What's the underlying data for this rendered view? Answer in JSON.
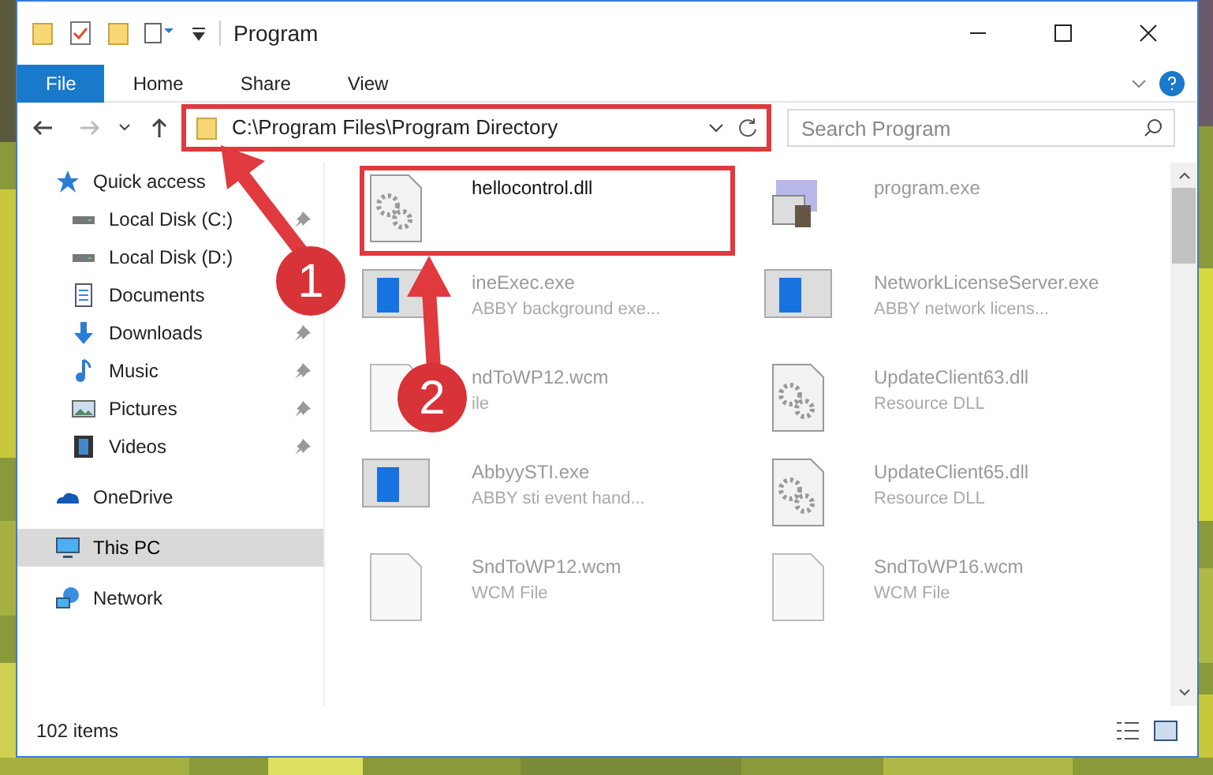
{
  "window": {
    "title": "Program"
  },
  "ribbon": {
    "tabs": [
      {
        "label": "File",
        "selected": true
      },
      {
        "label": "Home",
        "selected": false
      },
      {
        "label": "Share",
        "selected": false
      },
      {
        "label": "View",
        "selected": false
      }
    ]
  },
  "address": {
    "path": "C:\\Program Files\\Program Directory"
  },
  "search": {
    "placeholder": "Search Program"
  },
  "sidebar": {
    "items": [
      {
        "label": "Quick access",
        "kind": "star",
        "pinned": false,
        "selected": false,
        "children": [
          {
            "label": "Local Disk (C:)",
            "kind": "drive",
            "pinned": true,
            "selected": false
          },
          {
            "label": "Local Disk (D:)",
            "kind": "drive",
            "pinned": false,
            "selected": false
          },
          {
            "label": "Documents",
            "kind": "doc",
            "pinned": false,
            "selected": false
          },
          {
            "label": "Downloads",
            "kind": "download",
            "pinned": true,
            "selected": false
          },
          {
            "label": "Music",
            "kind": "music",
            "pinned": true,
            "selected": false
          },
          {
            "label": "Pictures",
            "kind": "pictures",
            "pinned": true,
            "selected": false
          },
          {
            "label": "Videos",
            "kind": "videos",
            "pinned": true,
            "selected": false
          }
        ]
      },
      {
        "label": "OneDrive",
        "kind": "cloud",
        "pinned": false,
        "selected": false
      },
      {
        "label": "This PC",
        "kind": "pc",
        "pinned": false,
        "selected": true
      },
      {
        "label": "Network",
        "kind": "network",
        "pinned": false,
        "selected": false
      }
    ]
  },
  "files": [
    {
      "name": "hellocontrol.dll",
      "kind": "dll",
      "highlighted": true
    },
    {
      "name": "program.exe",
      "kind": "exe",
      "highlighted": false
    },
    {
      "name": "ineExec.exe",
      "description": "ABBY background exe...",
      "kind": "window",
      "highlighted": false
    },
    {
      "name": "NetworkLicenseServer.exe",
      "description": "ABBY network licens...",
      "kind": "window",
      "highlighted": false
    },
    {
      "name": "ndToWP12.wcm",
      "description": "ile",
      "kind": "blank",
      "highlighted": false
    },
    {
      "name": "UpdateClient63.dll",
      "description": "Resource DLL",
      "kind": "dll",
      "highlighted": false
    },
    {
      "name": "AbbyySTI.exe",
      "description": "ABBY sti event hand...",
      "kind": "window",
      "highlighted": false
    },
    {
      "name": "UpdateClient65.dll",
      "description": "Resource DLL",
      "kind": "dll",
      "highlighted": false
    },
    {
      "name": "SndToWP12.wcm",
      "description": "WCM File",
      "kind": "blank",
      "highlighted": false
    },
    {
      "name": "SndToWP16.wcm",
      "description": "WCM File",
      "kind": "blank",
      "highlighted": false
    }
  ],
  "status_bar": {
    "item_count": "102 items"
  },
  "annotations": [
    {
      "label": "1"
    },
    {
      "label": "2"
    }
  ]
}
